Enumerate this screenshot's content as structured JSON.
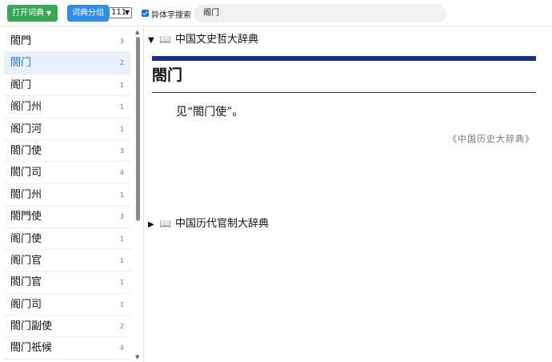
{
  "toolbar": {
    "open_dict_label": "打开词典",
    "dict_group_label": "词典分组",
    "group_select_value": "111",
    "variant_search_label": "异体字搜索",
    "search_value": "阁门"
  },
  "sidebar": {
    "items": [
      {
        "word": "閤門",
        "count": "3"
      },
      {
        "word": "閤门",
        "count": "2"
      },
      {
        "word": "阁门",
        "count": "1"
      },
      {
        "word": "阁门州",
        "count": "1"
      },
      {
        "word": "阁门河",
        "count": "1"
      },
      {
        "word": "閤门使",
        "count": "3"
      },
      {
        "word": "閤门司",
        "count": "4"
      },
      {
        "word": "閤门州",
        "count": "1"
      },
      {
        "word": "閤門使",
        "count": "3"
      },
      {
        "word": "阁门使",
        "count": "1"
      },
      {
        "word": "阁门官",
        "count": "1"
      },
      {
        "word": "閤门官",
        "count": "1"
      },
      {
        "word": "阁门司",
        "count": "1"
      },
      {
        "word": "閤门副使",
        "count": "2"
      },
      {
        "word": "閤门祇候",
        "count": "4"
      }
    ],
    "active_index": 1
  },
  "main": {
    "dict1": {
      "name": "中国文史哲大辞典",
      "headword": "閤门",
      "definition": "见“閤门使”。",
      "source": "《中国历史大辞典》"
    },
    "dict2": {
      "name": "中国历代官制大辞典"
    },
    "expanded_glyph": "▼",
    "collapsed_glyph": "▶",
    "book_glyph": "📖"
  },
  "colors": {
    "open_button": "#3aa757",
    "group_button": "#2f8ee8",
    "active_item": "#1a73e8",
    "rule": "#1b2f7e"
  },
  "icons": [
    "chevron-down-icon",
    "checkbox-checked-icon",
    "book-icon",
    "triangle-down-icon",
    "triangle-right-icon",
    "scroll-up-icon",
    "scroll-down-icon"
  ]
}
